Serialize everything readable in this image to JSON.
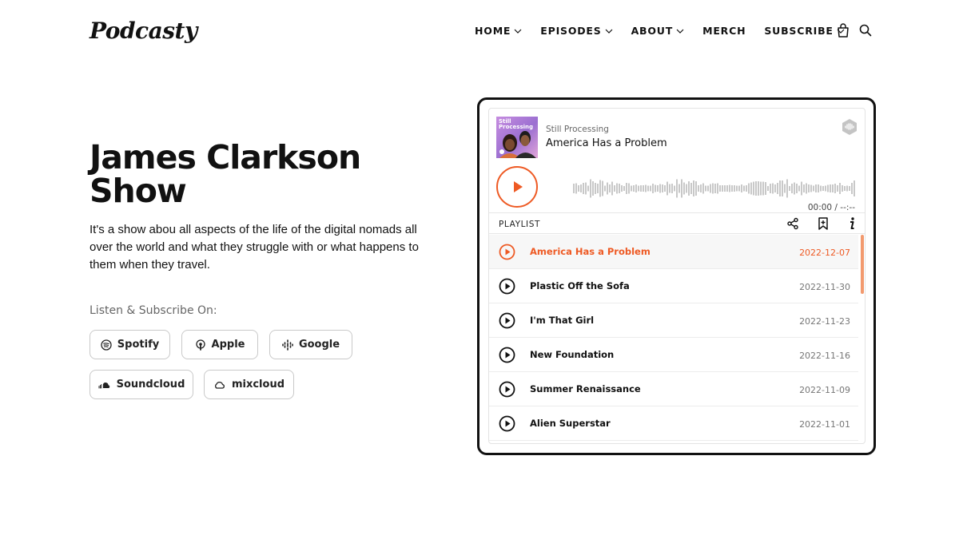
{
  "header": {
    "logo": "Podcasty",
    "nav": [
      {
        "label": "HOME",
        "dropdown": true
      },
      {
        "label": "EPISODES",
        "dropdown": true
      },
      {
        "label": "ABOUT",
        "dropdown": true
      },
      {
        "label": "MERCH",
        "dropdown": false
      },
      {
        "label": "SUBSCRIBE",
        "dropdown": true
      }
    ],
    "icons": [
      "cart-icon",
      "search-icon"
    ]
  },
  "hero": {
    "title": "James Clarkson Show",
    "description": "It's a show abou all aspects of the life of the digital nomads all over the world and what they struggle with or what happens to them when they travel.",
    "listen_label": "Listen & Subscribe On:",
    "platforms": [
      {
        "label": "Spotify",
        "icon": "spotify-icon"
      },
      {
        "label": "Apple",
        "icon": "apple-podcasts-icon"
      },
      {
        "label": "Google",
        "icon": "google-podcasts-icon"
      },
      {
        "label": "Soundcloud",
        "icon": "soundcloud-icon"
      },
      {
        "label": "mixcloud",
        "icon": "mixcloud-icon"
      }
    ]
  },
  "player": {
    "cover_text": "Still Processing",
    "show_name": "Still Processing",
    "episode_title": "America Has a Problem",
    "time": "00:00 / --:--",
    "playlist_label": "PLAYLIST",
    "accent": "#ee5a24",
    "tracks": [
      {
        "title": "America Has a Problem",
        "date": "2022-12-07",
        "active": true
      },
      {
        "title": "Plastic Off the Sofa",
        "date": "2022-11-30",
        "active": false
      },
      {
        "title": "I'm That Girl",
        "date": "2022-11-23",
        "active": false
      },
      {
        "title": "New Foundation",
        "date": "2022-11-16",
        "active": false
      },
      {
        "title": "Summer Renaissance",
        "date": "2022-11-09",
        "active": false
      },
      {
        "title": "Alien Superstar",
        "date": "2022-11-01",
        "active": false
      }
    ]
  }
}
